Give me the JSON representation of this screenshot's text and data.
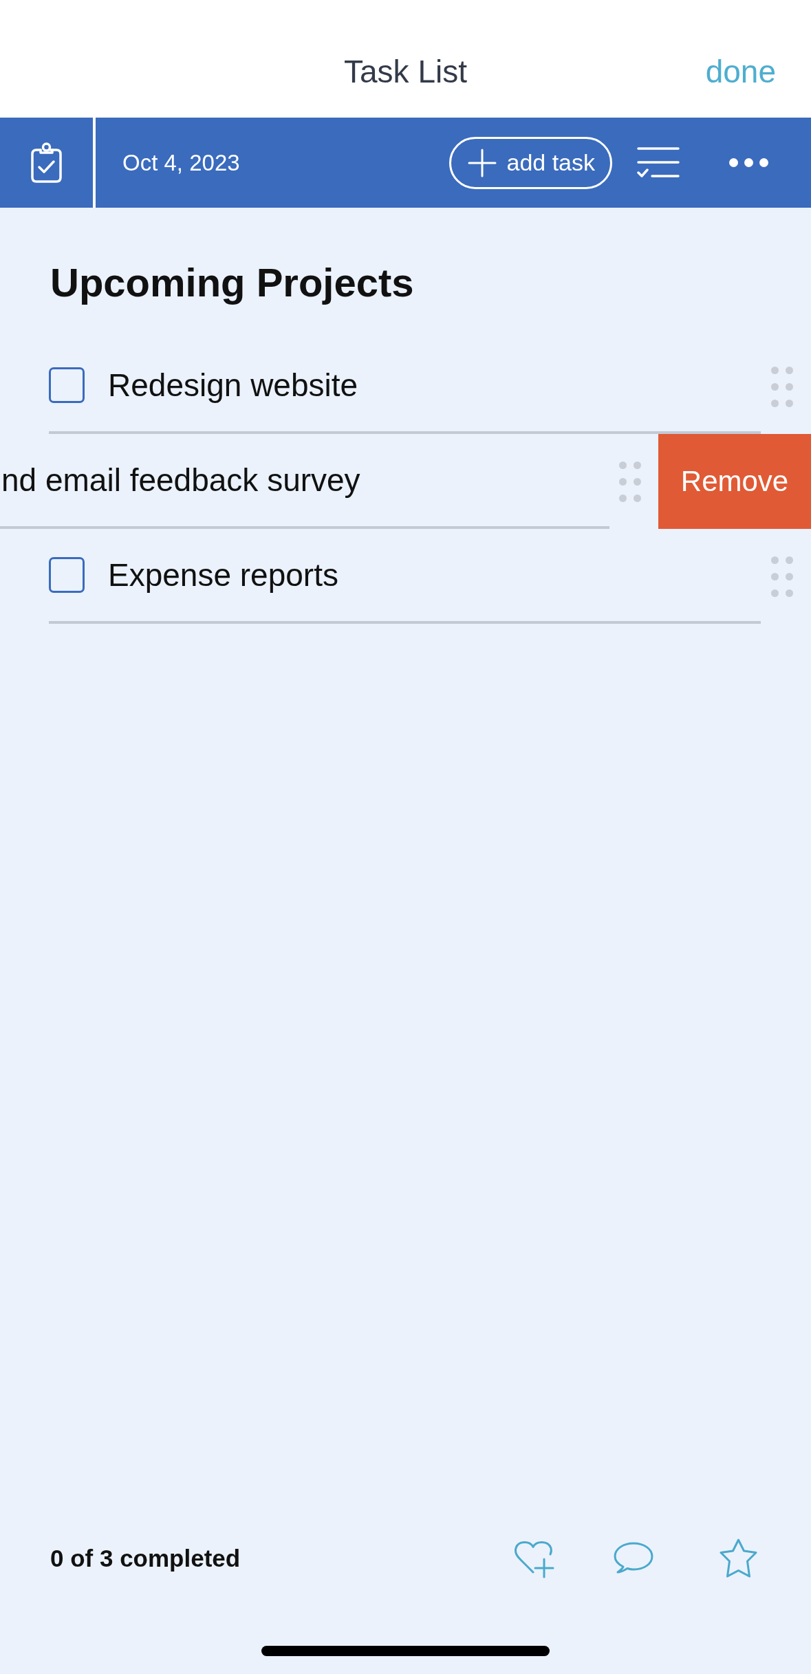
{
  "header": {
    "title": "Task List",
    "done": "done"
  },
  "toolbar": {
    "date": "Oct 4, 2023",
    "add_button": "add task"
  },
  "list": {
    "title": "Upcoming Projects",
    "tasks": [
      {
        "kind": "task",
        "text": "Redesign website",
        "checked": false
      },
      {
        "kind": "swiped",
        "text": "nd email feedback survey",
        "action": "Remove"
      },
      {
        "kind": "task",
        "text": "Expense reports",
        "checked": false
      }
    ]
  },
  "footer": {
    "summary": "0 of 3 completed"
  }
}
